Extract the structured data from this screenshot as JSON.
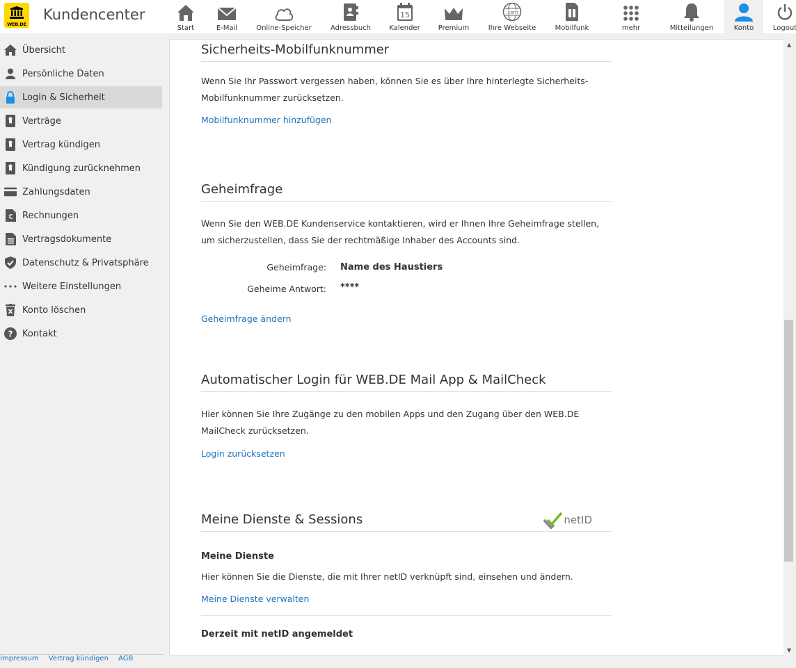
{
  "app": {
    "logo_text": "WEB.DE",
    "title": "Kundencenter"
  },
  "nav": [
    {
      "label": "Start",
      "icon": "home-icon"
    },
    {
      "label": "E-Mail",
      "icon": "mail-icon"
    },
    {
      "label": "Online-Speicher",
      "icon": "cloud-icon"
    },
    {
      "label": "Adressbuch",
      "icon": "addressbook-icon"
    },
    {
      "label": "Kalender",
      "icon": "calendar-icon",
      "badge": "15"
    },
    {
      "label": "Premium",
      "icon": "crown-icon"
    },
    {
      "label": "Ihre Webseite",
      "icon": "globe-icon",
      "badge": ".com"
    },
    {
      "label": "Mobilfunk",
      "icon": "sim-icon"
    },
    {
      "label": "mehr",
      "icon": "grid-icon"
    },
    {
      "label": "Mitteilungen",
      "icon": "bell-icon"
    },
    {
      "label": "Konto",
      "icon": "user-icon"
    },
    {
      "label": "Logout",
      "icon": "power-icon"
    }
  ],
  "sidebar": [
    {
      "label": "Übersicht",
      "icon": "home-icon"
    },
    {
      "label": "Persönliche Daten",
      "icon": "person-icon"
    },
    {
      "label": "Login & Sicherheit",
      "icon": "lock-icon"
    },
    {
      "label": "Verträge",
      "icon": "contract-icon"
    },
    {
      "label": "Vertrag kündigen",
      "icon": "contract-icon"
    },
    {
      "label": "Kündigung zurücknehmen",
      "icon": "contract-icon"
    },
    {
      "label": "Zahlungsdaten",
      "icon": "card-icon"
    },
    {
      "label": "Rechnungen",
      "icon": "euro-doc-icon"
    },
    {
      "label": "Vertragsdokumente",
      "icon": "document-icon"
    },
    {
      "label": "Datenschutz & Privatsphäre",
      "icon": "shield-icon"
    },
    {
      "label": "Weitere Einstellungen",
      "icon": "dots-icon"
    },
    {
      "label": "Konto löschen",
      "icon": "trash-icon"
    },
    {
      "label": "Kontakt",
      "icon": "help-icon"
    }
  ],
  "footer": {
    "impressum": "Impressum",
    "vertrag": "Vertrag kündigen",
    "agb": "AGB"
  },
  "sections": {
    "mobil": {
      "title": "Sicherheits-Mobilfunknummer",
      "text": "Wenn Sie Ihr Passwort vergessen haben, können Sie es über Ihre hinterlegte Sicherheits-Mobilfunknummer zurücksetzen.",
      "link": "Mobilfunknummer hinzufügen"
    },
    "frage": {
      "title": "Geheimfrage",
      "text": "Wenn Sie den WEB.DE Kundenservice kontaktieren, wird er Ihnen Ihre Geheimfrage stellen, um sicherzustellen, dass Sie der rechtmäßige Inhaber des Accounts sind.",
      "question_label": "Geheimfrage:",
      "question_value": "Name des Haustiers",
      "answer_label": "Geheime Antwort:",
      "answer_value": "****",
      "link": "Geheimfrage ändern"
    },
    "auto": {
      "title": "Automatischer Login für WEB.DE Mail App & MailCheck",
      "text": "Hier können Sie Ihre Zugänge zu den mobilen Apps und den Zugang über den WEB.DE MailCheck zurücksetzen.",
      "link": "Login zurücksetzen"
    },
    "dienste": {
      "title": "Meine Dienste & Sessions",
      "netid": "netID",
      "sub1": "Meine Dienste",
      "text": "Hier können Sie die Dienste, die mit Ihrer netID verknüpft sind, einsehen und ändern.",
      "link": "Meine Dienste verwalten",
      "sub2": "Derzeit mit netID angemeldet"
    }
  },
  "colors": {
    "accent": "#1e73be",
    "active_user": "#1a8fe3",
    "logo": "#ffd800"
  }
}
